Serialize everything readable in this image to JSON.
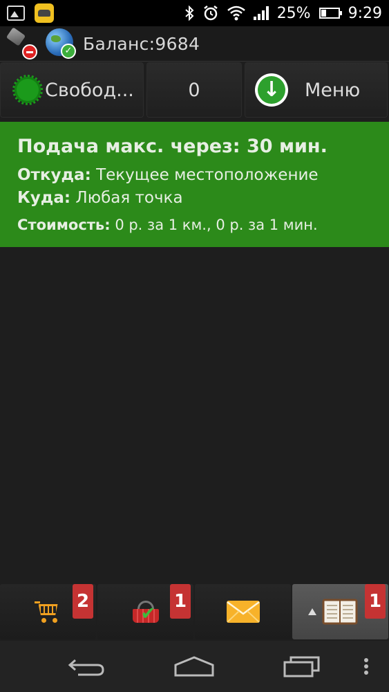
{
  "status_bar": {
    "battery_percent": "25%",
    "time": "9:29",
    "icons": [
      "image-icon",
      "taxi-app-icon",
      "bluetooth-icon",
      "alarm-icon",
      "wifi-icon",
      "signal-icon",
      "battery-icon"
    ]
  },
  "header": {
    "gps_icon": "gps-disabled-icon",
    "network_icon": "network-connected-icon",
    "balance": "Баланс:9684"
  },
  "top_buttons": {
    "status_label": "Свобод...",
    "count_label": "0",
    "menu_label": "Меню"
  },
  "order": {
    "title": "Подача макс. через: 30 мин.",
    "from_label": "Откуда:",
    "from_value": "Текущее местоположение",
    "to_label": "Куда:",
    "to_value": "Любая точка",
    "cost_label": "Стоимость:",
    "cost_value": "0 р. за 1 км., 0 р. за 1 мин."
  },
  "bottom_bar": {
    "tabs": [
      {
        "icon": "shopping-cart-icon",
        "badge": "2"
      },
      {
        "icon": "basket-check-icon",
        "badge": "1"
      },
      {
        "icon": "envelope-icon",
        "badge": ""
      },
      {
        "icon": "journal-icon",
        "badge": "1"
      }
    ]
  },
  "colors": {
    "order_panel": "#2c8a1a",
    "badge": "#c53333",
    "background": "#1e1e1e"
  }
}
